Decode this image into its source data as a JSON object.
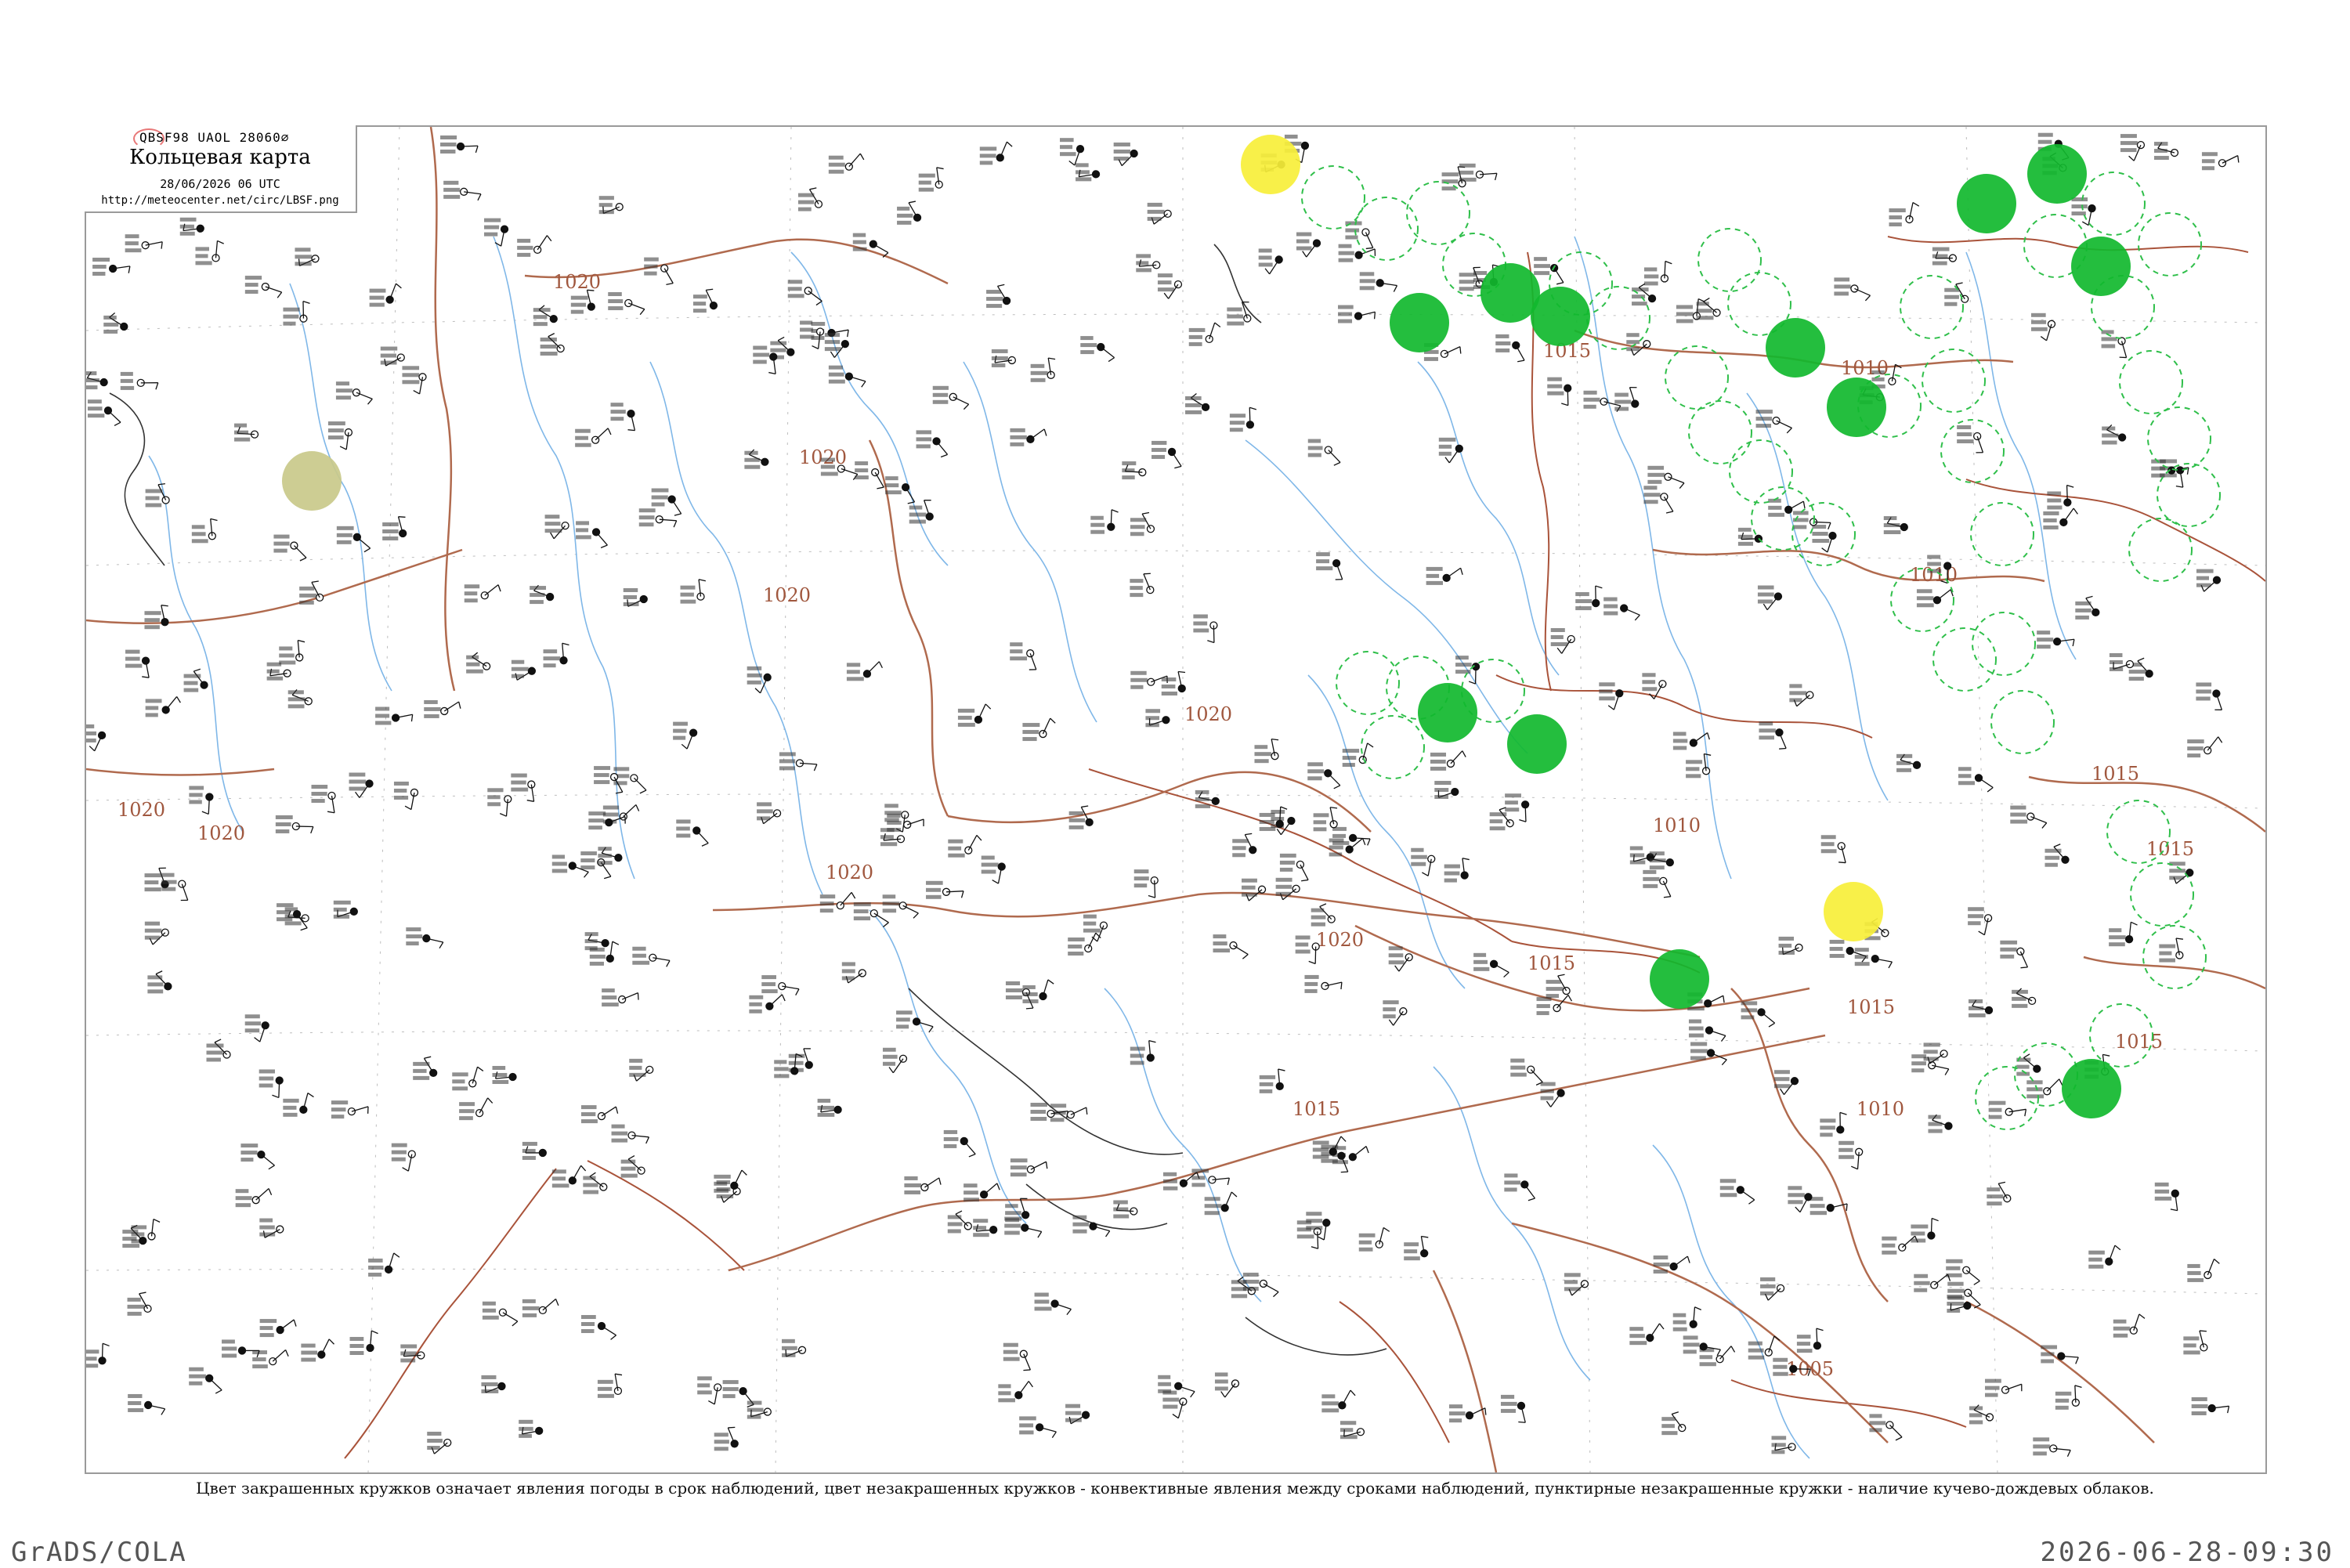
{
  "header": {
    "code": "QBSF98  UAOL  28060∅",
    "title": "Кольцевая карта",
    "time": "28/06/2026 06 UTC",
    "url": "http://meteocenter.net/circ/LBSF.png"
  },
  "legend": {
    "caption": "Цвет закрашенных кружков означает явления погоды в срок наблюдений, цвет незакрашенных кружков - конвективные явления между сроками наблюдений, пунктирные незакрашенные кружки - наличие кучево-дождевых облаков."
  },
  "footer": {
    "software": "GrADS/COLA",
    "timestamp": "2026-06-28-09:30"
  },
  "isobars": [
    "1020",
    "1020",
    "1020",
    "1020",
    "1020",
    "1020",
    "1020",
    "1020",
    "1015",
    "1015",
    "1015",
    "1015",
    "1015",
    "1015",
    "1015",
    "1010",
    "1010",
    "1010",
    "1010",
    "1005"
  ],
  "colors": {
    "isobar": "#b06a4e",
    "river": "#7fb7e8",
    "border": "#a9533a",
    "rain_fill": "#11b82e",
    "rain_dashed": "#2fbf4a",
    "haze_fill": "#f7ef3a",
    "dust_fill": "#c9c98a",
    "frame": "#9a9a9a"
  },
  "weather_markers": {
    "filled_green": 12,
    "filled_yellow": 2,
    "filled_olive": 1,
    "dashed_green": 40
  }
}
